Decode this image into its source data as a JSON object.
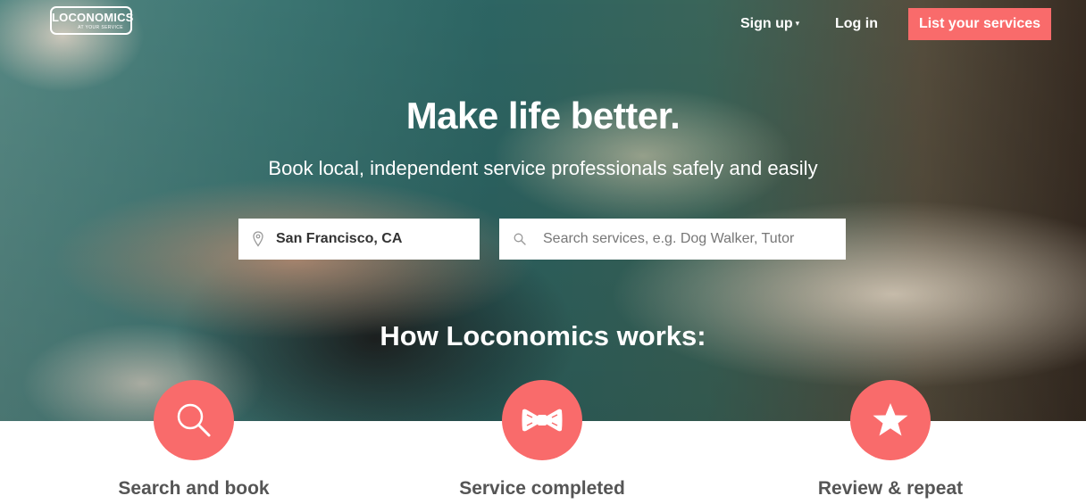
{
  "brand": {
    "logo_text": "LOCONOMICS",
    "logo_tagline": "AT YOUR SERVICE"
  },
  "nav": {
    "signup_label": "Sign up",
    "login_label": "Log in",
    "cta_label": "List your services"
  },
  "hero": {
    "headline": "Make life better.",
    "subhead": "Book local, independent service professionals safely and easily"
  },
  "search": {
    "location_value": "San Francisco, CA",
    "placeholder": "Search services, e.g. Dog Walker, Tutor"
  },
  "how_it_works": {
    "title": "How Loconomics works:",
    "steps": [
      {
        "label": "Search and book",
        "icon": "magnifier-icon"
      },
      {
        "label": "Service completed",
        "icon": "bow-tie-icon"
      },
      {
        "label": "Review & repeat",
        "icon": "star-icon"
      }
    ]
  },
  "colors": {
    "accent": "#f96b6b",
    "step_text": "#555555"
  }
}
